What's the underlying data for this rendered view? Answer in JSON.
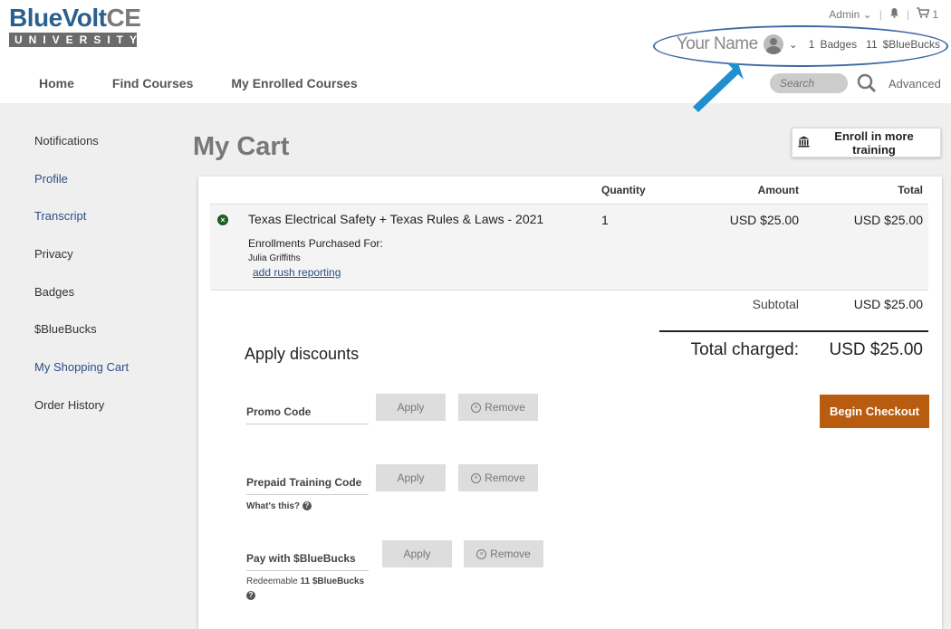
{
  "logo": {
    "text_blue": "BlueVolt",
    "text_gray": "CE",
    "sub": "UNIVERSITY"
  },
  "topbar": {
    "admin_label": "Admin",
    "cart_count": "1"
  },
  "user": {
    "name": "Your Name",
    "badges_count": "1",
    "badges_label": "Badges",
    "bluebucks_count": "11",
    "bluebucks_label": "$BlueBucks"
  },
  "nav": {
    "items": [
      "Home",
      "Find Courses",
      "My Enrolled Courses"
    ]
  },
  "search": {
    "placeholder": "Search",
    "advanced_label": "Advanced"
  },
  "sidebar": {
    "items": [
      "Notifications",
      "Profile",
      "Transcript",
      "Privacy",
      "Badges",
      "$BlueBucks",
      "My Shopping Cart",
      "Order History"
    ]
  },
  "page": {
    "title": "My Cart"
  },
  "enroll_more": {
    "label": "Enroll in more training"
  },
  "cart": {
    "headers": {
      "quantity": "Quantity",
      "amount": "Amount",
      "total": "Total"
    },
    "item": {
      "name": "Texas Electrical Safety + Texas Rules & Laws - 2021",
      "quantity": "1",
      "amount": "USD $25.00",
      "total": "USD $25.00",
      "purchased_for_label": "Enrollments Purchased For:",
      "purchased_for_name": "Julia Griffiths",
      "rush_link": "add rush reporting"
    },
    "subtotal_label": "Subtotal",
    "subtotal_value": "USD $25.00",
    "total_charged_label": "Total charged:",
    "total_charged_value": "USD $25.00"
  },
  "discounts": {
    "title": "Apply discounts",
    "promo_label": "Promo Code",
    "prepaid_label": "Prepaid Training Code",
    "whats_this": "What's this?",
    "bluebucks_label": "Pay with $BlueBucks",
    "redeemable_prefix": "Redeemable",
    "redeemable_amount": "11 $BlueBucks",
    "apply_label": "Apply",
    "remove_label": "Remove"
  },
  "checkout": {
    "label": "Begin Checkout"
  },
  "colors": {
    "brand_blue": "#2b5f8e",
    "checkout_orange": "#b85c0f",
    "annotation_blue": "#3d6aa3",
    "arrow_blue": "#1f8fcf"
  }
}
